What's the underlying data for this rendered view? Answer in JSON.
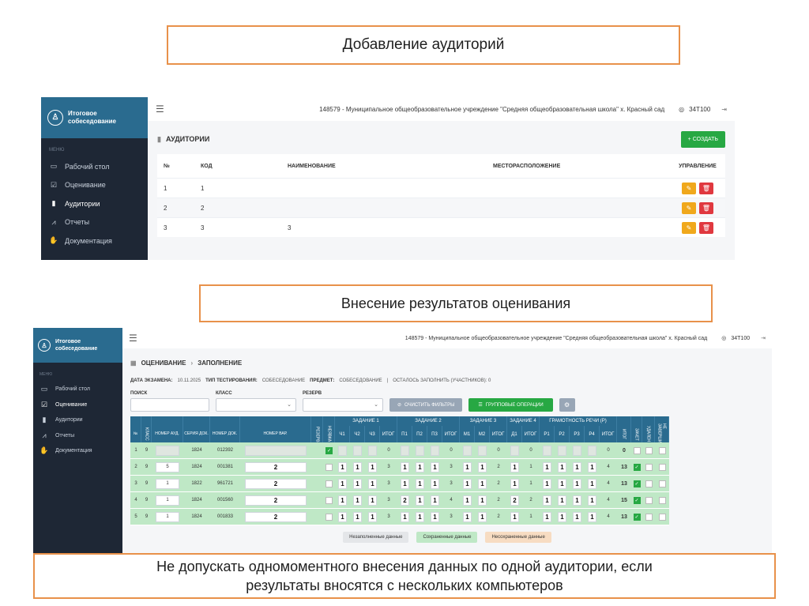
{
  "captions": {
    "c1": "Добавление аудиторий",
    "c2": "Внесение результатов оценивания",
    "c3_line1": "Не допускать одномоментного внесения данных по одной аудитории, если",
    "c3_line2": "результаты вносятся с нескольких компьютеров"
  },
  "app": {
    "title_line1": "Итоговое",
    "title_line2": "собеседование",
    "menu_caption": "МЕНЮ",
    "menu": [
      {
        "label": "Рабочий стол",
        "icon": "desktop-icon"
      },
      {
        "label": "Оценивание",
        "icon": "checkbox-icon"
      },
      {
        "label": "Аудитории",
        "icon": "door-icon"
      },
      {
        "label": "Отчеты",
        "icon": "chart-icon"
      },
      {
        "label": "Документация",
        "icon": "hand-icon"
      }
    ],
    "org": "148579 - Муниципальное общеобразовательное учреждение \"Средняя общеобразовательная школа\" х. Красный сад",
    "user": "34T100"
  },
  "auditoriums": {
    "page_title": "АУДИТОРИИ",
    "create_label": "+ СОЗДАТЬ",
    "columns": {
      "no": "№",
      "code": "КОД",
      "name": "НАИМЕНОВАНИЕ",
      "location": "МЕСТОРАСПОЛОЖЕНИЕ",
      "control": "УПРАВЛЕНИЕ"
    },
    "rows": [
      {
        "no": "1",
        "code": "1",
        "name": "",
        "location": ""
      },
      {
        "no": "2",
        "code": "2",
        "name": "",
        "location": ""
      },
      {
        "no": "3",
        "code": "3",
        "name": "3",
        "location": ""
      }
    ]
  },
  "assessment": {
    "crumb1": "ОЦЕНИВАНИЕ",
    "crumb2": "ЗАПОЛНЕНИЕ",
    "meta": {
      "date_label": "ДАТА ЭКЗАМЕНА:",
      "date": "10.11.2025",
      "type_label": "ТИП ТЕСТИРОВАНИЯ:",
      "type": "СОБЕСЕДОВАНИЕ",
      "subject_label": "ПРЕДМЕТ:",
      "subject": "СОБЕСЕДОВАНИЕ",
      "remaining": "ОСТАЛОСЬ ЗАПОЛНИТЬ (УЧАСТНИКОВ): 0"
    },
    "filters": {
      "search": "ПОИСК",
      "class": "КЛАСС",
      "reserve": "РЕЗЕРВ"
    },
    "buttons": {
      "clear": "ОЧИСТИТЬ ФИЛЬТРЫ",
      "group": "ГРУППОВЫЕ ОПЕРАЦИИ"
    },
    "headers": {
      "no": "№",
      "class": "КЛАСС",
      "aud": "НОМЕР АУД.",
      "series": "СЕРИЯ ДОК.",
      "docno": "НОМЕР ДОК.",
      "variant": "НОМЕР ВАР.",
      "reserve": "РЕЗЕРВ",
      "absent": "НЕЯВКА",
      "task1": "ЗАДАНИЕ 1",
      "task2": "ЗАДАНИЕ 2",
      "task3": "ЗАДАНИЕ 3",
      "task4": "ЗАДАНИЕ 4",
      "literacy": "ГРАМОТНОСТЬ РЕЧИ (Р)",
      "total": "ИТОГ",
      "pass": "ЗАЧЕТ",
      "removed": "УДАЛЕН",
      "notfinished": "НЕ ЗАВЕРШИЛ",
      "sub1": [
        "Ч1",
        "Ч2",
        "Ч3",
        "ИТОГ"
      ],
      "sub2": [
        "П1",
        "П2",
        "П3",
        "ИТОГ"
      ],
      "sub3": [
        "М1",
        "М2",
        "ИТОГ"
      ],
      "sub4": [
        "Д1",
        "ИТОГ"
      ],
      "sub5": [
        "Р1",
        "Р2",
        "Р3",
        "Р4",
        "ИТОГ"
      ]
    },
    "legend": {
      "unfilled": "Незаполненные данные",
      "saved": "Сохраненные данные",
      "unsaved": "Несохраненные данные"
    },
    "rows": [
      {
        "no": "1",
        "cls": "9",
        "aud": "",
        "series": "1824",
        "doc": "012392",
        "var": "",
        "absent": true,
        "t1": [
          "",
          "",
          ""
        ],
        "t1s": "0",
        "t2": [
          "",
          "",
          ""
        ],
        "t2s": "0",
        "t3": [
          "",
          ""
        ],
        "t3s": "0",
        "t4": [
          ""
        ],
        "t4s": "0",
        "r": [
          "",
          "",
          "",
          ""
        ],
        "rs": "0",
        "total": "0",
        "pass": false
      },
      {
        "no": "2",
        "cls": "9",
        "aud": "5",
        "series": "1824",
        "doc": "001381",
        "var": "2",
        "absent": false,
        "t1": [
          "1",
          "1",
          "1"
        ],
        "t1s": "3",
        "t2": [
          "1",
          "1",
          "1"
        ],
        "t2s": "3",
        "t3": [
          "1",
          "1"
        ],
        "t3s": "2",
        "t4": [
          "1"
        ],
        "t4s": "1",
        "r": [
          "1",
          "1",
          "1",
          "1"
        ],
        "rs": "4",
        "total": "13",
        "pass": true
      },
      {
        "no": "3",
        "cls": "9",
        "aud": "1",
        "series": "1822",
        "doc": "961721",
        "var": "2",
        "absent": false,
        "t1": [
          "1",
          "1",
          "1"
        ],
        "t1s": "3",
        "t2": [
          "1",
          "1",
          "1"
        ],
        "t2s": "3",
        "t3": [
          "1",
          "1"
        ],
        "t3s": "2",
        "t4": [
          "1"
        ],
        "t4s": "1",
        "r": [
          "1",
          "1",
          "1",
          "1"
        ],
        "rs": "4",
        "total": "13",
        "pass": true
      },
      {
        "no": "4",
        "cls": "9",
        "aud": "1",
        "series": "1824",
        "doc": "001560",
        "var": "2",
        "absent": false,
        "t1": [
          "1",
          "1",
          "1"
        ],
        "t1s": "3",
        "t2": [
          "2",
          "1",
          "1"
        ],
        "t2s": "4",
        "t3": [
          "1",
          "1"
        ],
        "t3s": "2",
        "t4": [
          "2"
        ],
        "t4s": "2",
        "r": [
          "1",
          "1",
          "1",
          "1"
        ],
        "rs": "4",
        "total": "15",
        "pass": true
      },
      {
        "no": "5",
        "cls": "9",
        "aud": "1",
        "series": "1824",
        "doc": "001833",
        "var": "2",
        "absent": false,
        "t1": [
          "1",
          "1",
          "1"
        ],
        "t1s": "3",
        "t2": [
          "1",
          "1",
          "1"
        ],
        "t2s": "3",
        "t3": [
          "1",
          "1"
        ],
        "t3s": "2",
        "t4": [
          "1"
        ],
        "t4s": "1",
        "r": [
          "1",
          "1",
          "1",
          "1"
        ],
        "rs": "4",
        "total": "13",
        "pass": true
      }
    ]
  }
}
